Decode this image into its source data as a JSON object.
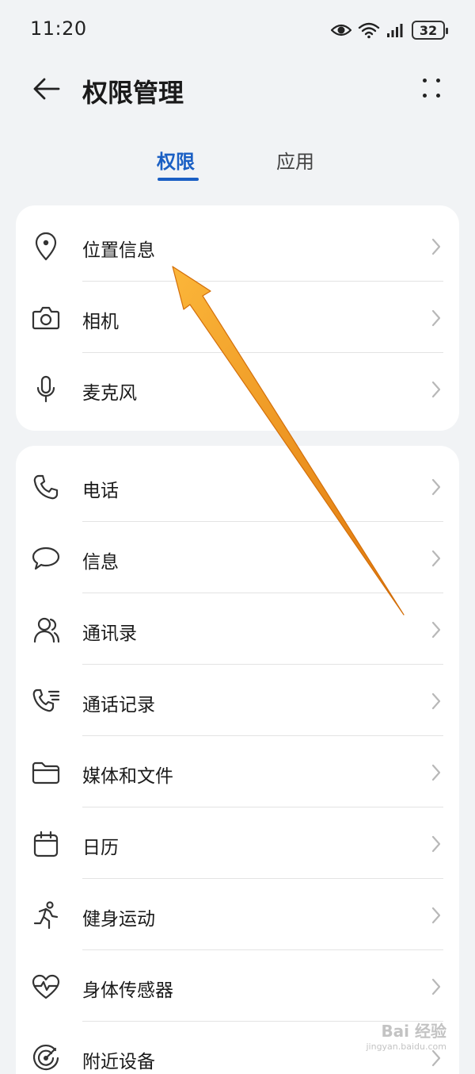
{
  "status_bar": {
    "time": "11:20",
    "battery": "32",
    "icons": [
      "eye-icon",
      "wifi-icon",
      "signal-icon",
      "battery-icon"
    ]
  },
  "header": {
    "title": "权限管理",
    "back_icon": "back-arrow-icon",
    "more_icon": "more-dots-icon"
  },
  "tabs": [
    {
      "label": "权限",
      "active": true
    },
    {
      "label": "应用",
      "active": false
    }
  ],
  "colors": {
    "accent": "#1a5fc4",
    "background": "#f1f3f5",
    "card": "#ffffff",
    "annotation": "#f5a31a"
  },
  "groups": [
    {
      "items": [
        {
          "label": "位置信息",
          "icon": "location-pin-icon"
        },
        {
          "label": "相机",
          "icon": "camera-icon"
        },
        {
          "label": "麦克风",
          "icon": "microphone-icon"
        }
      ]
    },
    {
      "items": [
        {
          "label": "电话",
          "icon": "phone-icon"
        },
        {
          "label": "信息",
          "icon": "message-icon"
        },
        {
          "label": "通讯录",
          "icon": "contacts-icon"
        },
        {
          "label": "通话记录",
          "icon": "call-log-icon"
        },
        {
          "label": "媒体和文件",
          "icon": "folder-icon"
        },
        {
          "label": "日历",
          "icon": "calendar-icon"
        },
        {
          "label": "健身运动",
          "icon": "running-icon"
        },
        {
          "label": "身体传感器",
          "icon": "heart-rate-icon"
        },
        {
          "label": "附近设备",
          "icon": "nearby-devices-icon"
        }
      ]
    }
  ],
  "watermark": {
    "text": "Bai 经验",
    "sub": "jingyan.baidu.com"
  }
}
